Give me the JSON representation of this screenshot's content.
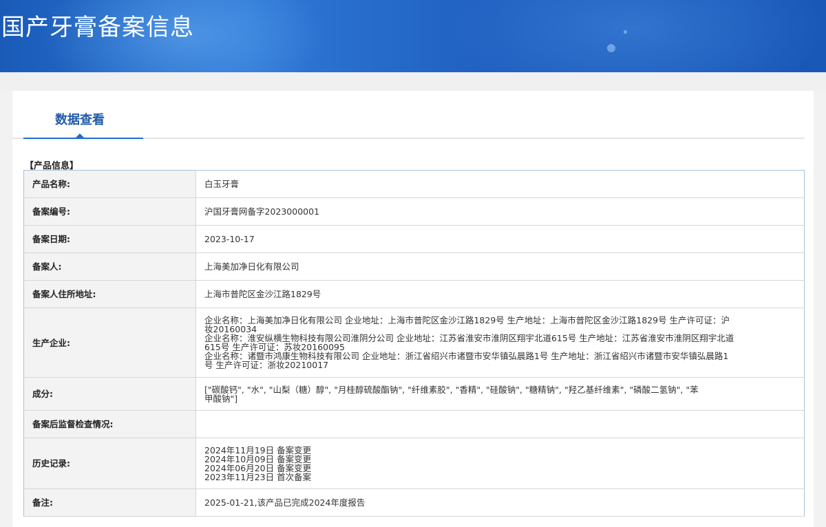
{
  "header": {
    "title": "国产牙膏备案信息"
  },
  "tab": {
    "label": "数据查看"
  },
  "section": {
    "title": "【产品信息】"
  },
  "rows": {
    "product_name": {
      "label": "产品名称:",
      "value": "白玉牙膏"
    },
    "filing_number": {
      "label": "备案编号:",
      "value": "沪国牙膏网备字2023000001"
    },
    "filing_date": {
      "label": "备案日期:",
      "value": "2023-10-17"
    },
    "filer": {
      "label": "备案人:",
      "value": "上海美加净日化有限公司"
    },
    "filer_address": {
      "label": "备案人住所地址:",
      "value": "上海市普陀区金沙江路1829号"
    },
    "manufacturer": {
      "label": "生产企业:",
      "lines": [
        "企业名称：上海美加净日化有限公司 企业地址：上海市普陀区金沙江路1829号 生产地址：上海市普陀区金沙江路1829号 生产许可证：沪",
        "妆20160034",
        "企业名称：淮安纵横生物科技有限公司淮阴分公司 企业地址：江苏省淮安市淮阴区翔宇北道615号 生产地址：江苏省淮安市淮阴区翔宇北道",
        "615号 生产许可证：苏妆20160095",
        "企业名称：诸暨市鸿康生物科技有限公司 企业地址：浙江省绍兴市诸暨市安华镇弘晨路1号 生产地址：浙江省绍兴市诸暨市安华镇弘晨路1",
        "号 生产许可证：浙妆20210017"
      ]
    },
    "ingredients": {
      "label": "成分:",
      "lines": [
        "[\"碳酸钙\", \"水\", \"山梨（糖）醇\", \"月桂醇硫酸酯钠\", \"纤维素胶\", \"香精\", \"硅酸钠\", \"糖精钠\", \"羟乙基纤维素\", \"磷酸二氢钠\", \"苯",
        "甲酸钠\"]"
      ]
    },
    "supervision": {
      "label": "备案后监督检查情况:",
      "value": ""
    },
    "history": {
      "label": "历史记录:",
      "lines": [
        "2024年11月19日 备案变更",
        "2024年10月09日 备案变更",
        "2024年06月20日 备案变更",
        "2023年11月23日 首次备案"
      ]
    },
    "remark": {
      "label": "备注:",
      "value": "2025-01-21,该产品已完成2024年度报告"
    }
  },
  "colors": {
    "banner": "#1f5fc0",
    "tab_text": "#1f5aa8",
    "tab_underline": "#1f6fc5",
    "label_bg": "#f3f3f3",
    "table_border": "#a9bfdc"
  }
}
